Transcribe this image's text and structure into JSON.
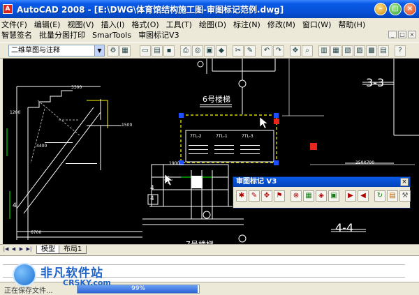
{
  "window": {
    "title": "AutoCAD 2008 - [E:\\DWG\\体育馆结构施工图-审图标记范例.dwg]",
    "app_icon_glyph": "A",
    "min_glyph": "–",
    "max_glyph": "□",
    "close_glyph": "×"
  },
  "menubar": {
    "items": [
      "文件(F)",
      "编辑(E)",
      "视图(V)",
      "插入(I)",
      "格式(O)",
      "工具(T)",
      "绘图(D)",
      "标注(N)",
      "修改(M)",
      "窗口(W)",
      "帮助(H)"
    ],
    "items2": [
      "智慧签名",
      "批量分图打印",
      "SmarTools",
      "审图标记V3"
    ],
    "doc_buttons": [
      "_",
      "□",
      "×"
    ]
  },
  "toolbar": {
    "workspace_value": "二维草图与注释",
    "workspace_arrow": "▼",
    "button_icons": [
      "new-icon",
      "open-icon",
      "save-icon",
      "print-icon",
      "preview-icon",
      "publish-icon",
      "cut-icon",
      "copy-icon",
      "paste-icon",
      "match-icon",
      "undo-icon",
      "redo-icon",
      "pan-icon",
      "zoom-icon",
      "zoom-window-icon",
      "zoom-previous-icon",
      "properties-icon",
      "design-center-icon",
      "tool-palette-icon",
      "sheet-set-icon",
      "markup-icon",
      "calculator-icon",
      "help-icon"
    ]
  },
  "drawing": {
    "labels": {
      "section_3_3": "3-3",
      "section_4_4": "4-4",
      "detail_6": "6号楼梯",
      "detail_7": "7号楼梯",
      "dim_3300": "3300",
      "dim_1500": "1500",
      "dim_1200": "1200",
      "dim_4400": "4400",
      "dim_6700": "6700",
      "dim_1900": "1900",
      "dim_250x700": "250X700",
      "tag_4a": "4",
      "tag_4b": "4",
      "tag_4c": "4",
      "beam_1": "7TL-2",
      "beam_2": "7TL-1",
      "beam_3": "7TL-3"
    }
  },
  "float_toolbar": {
    "title": "审图标记 V3",
    "close_glyph": "×",
    "buttons": [
      "cloud-mark-icon",
      "pen-icon",
      "move-mark-icon",
      "flag-icon",
      "link-icon",
      "excel-icon",
      "stamp-icon",
      "report-icon",
      "next-icon",
      "prev-icon",
      "refresh-icon",
      "book-icon",
      "tools-icon"
    ]
  },
  "layout_tabs": {
    "arrows": [
      "|◀",
      "◀",
      "▶",
      "▶|"
    ],
    "tabs": [
      "模型",
      "布局1"
    ],
    "active": "模型"
  },
  "statusbar": {
    "text": "正在保存文件...",
    "progress_percent": 99,
    "progress_label": "99%"
  },
  "watermark": {
    "name": "非凡软件站",
    "url": "CRSKY.com"
  },
  "colors": {
    "title_blue": "#0650d6",
    "canvas_bg": "#000000",
    "selection_grip": "#1e50ff",
    "selection_frame": "#ffff00",
    "progress_fill": "#2c64d6"
  }
}
